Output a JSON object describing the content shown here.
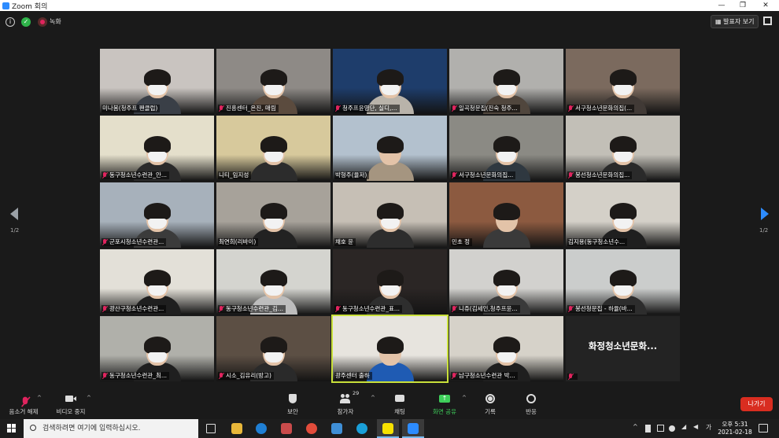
{
  "window": {
    "title": "Zoom 회의",
    "min": "—",
    "restore": "❐",
    "close": "✕"
  },
  "topbar": {
    "recording_label": "녹화",
    "speaker_view_label": "발표자 보기"
  },
  "pager": {
    "left": "1/2",
    "right": "1/2"
  },
  "participants": [
    {
      "name": "미나봄(청주프 팬클럽)",
      "muted": false,
      "bg": "#c9c4c0",
      "body": "#3a3f47"
    },
    {
      "name": "진흥센터_은진, 매림",
      "muted": true,
      "bg": "#8e8a86",
      "body": "#5b4b3e"
    },
    {
      "name": "청주프윤영단, 실디,...",
      "muted": true,
      "bg": "#1e3d6b",
      "body": "#b9b3aa"
    },
    {
      "name": "일곡청문집(진숙 청주...",
      "muted": true,
      "bg": "#b1b0ad",
      "body": "#50463d"
    },
    {
      "name": "서구청소년문화의집(...",
      "muted": true,
      "bg": "#7b6a5e",
      "body": "#413a36"
    },
    {
      "name": "동구청소년수련관_안...",
      "muted": true,
      "bg": "#e4dfcb",
      "body": "#2a2a2a"
    },
    {
      "name": "니티_임지성",
      "muted": false,
      "bg": "#d7c99c",
      "body": "#2c2c2c"
    },
    {
      "name": "박형주(율저)",
      "muted": false,
      "bg": "#b3c1ce",
      "body": "#a59580"
    },
    {
      "name": "서구청소년문화의집...",
      "muted": true,
      "bg": "#8b8a84",
      "body": "#2f3840"
    },
    {
      "name": "봉선청소년문화의집...",
      "muted": true,
      "bg": "#c2bfb7",
      "body": "#2a2a2a"
    },
    {
      "name": "군포시청소년수련관...",
      "muted": true,
      "bg": "#a7b1bb",
      "body": "#3b3b3b"
    },
    {
      "name": "최연희(리바이)",
      "muted": false,
      "bg": "#a7a29a",
      "body": "#222222"
    },
    {
      "name": "채호 윤",
      "muted": false,
      "bg": "#c6bfb5",
      "body": "#2d2d2d"
    },
    {
      "name": "민초 정",
      "muted": false,
      "bg": "#8c5a40",
      "body": "#3a3a3a"
    },
    {
      "name": "김지용(동구청소년수...",
      "muted": false,
      "bg": "#d4d0c8",
      "body": "#1f1f1f"
    },
    {
      "name": "광산구청소년수련관...",
      "muted": true,
      "bg": "#e3e0d8",
      "body": "#1f1f1f"
    },
    {
      "name": "동구청소년수련관_김...",
      "muted": true,
      "bg": "#d4d4cf",
      "body": "#bdbdbd"
    },
    {
      "name": "동구청소년수련관_표...",
      "muted": true,
      "bg": "#2b2625",
      "body": "#2e2e2e"
    },
    {
      "name": "니쥬(김세인,청주프윤...",
      "muted": true,
      "bg": "#d2d1ce",
      "body": "#3a3a3a"
    },
    {
      "name": "봉선청문집 - 하율(바...",
      "muted": true,
      "bg": "#cbcdcc",
      "body": "#2d2d2d"
    },
    {
      "name": "동구청소년수련관_최...",
      "muted": true,
      "bg": "#b0b0aa",
      "body": "#1f1f1f"
    },
    {
      "name": "시소_김유리(방고)",
      "muted": true,
      "bg": "#5c4f44",
      "body": "#2a2a2a"
    },
    {
      "name": "광주센터 출하",
      "muted": false,
      "bg": "#e7e4de",
      "body": "#1f5bb3",
      "active": true
    },
    {
      "name": "남구청소년수련관 박...",
      "muted": true,
      "bg": "#d6d2c9",
      "body": "#1f1f1f"
    },
    {
      "name": "",
      "muted": true,
      "text_only": "화정청소년문화..."
    }
  ],
  "controls": {
    "unmute": "음소거 해제",
    "stop_video": "비디오 중지",
    "security": "보안",
    "participants": "참가자",
    "participants_count": "29",
    "chat": "채팅",
    "share_screen": "화면 공유",
    "record": "기록",
    "reactions": "반응",
    "leave": "나가기"
  },
  "taskbar": {
    "search_placeholder": "검색하려면 여기에 입력하십시오.",
    "ime": "가",
    "time": "오후 5:31",
    "date": "2021-02-18"
  },
  "colors": {
    "accent": "#2d8cff",
    "share_green": "#3ecf5a",
    "leave_red": "#d92d20",
    "active_speaker": "#c9e03a"
  }
}
